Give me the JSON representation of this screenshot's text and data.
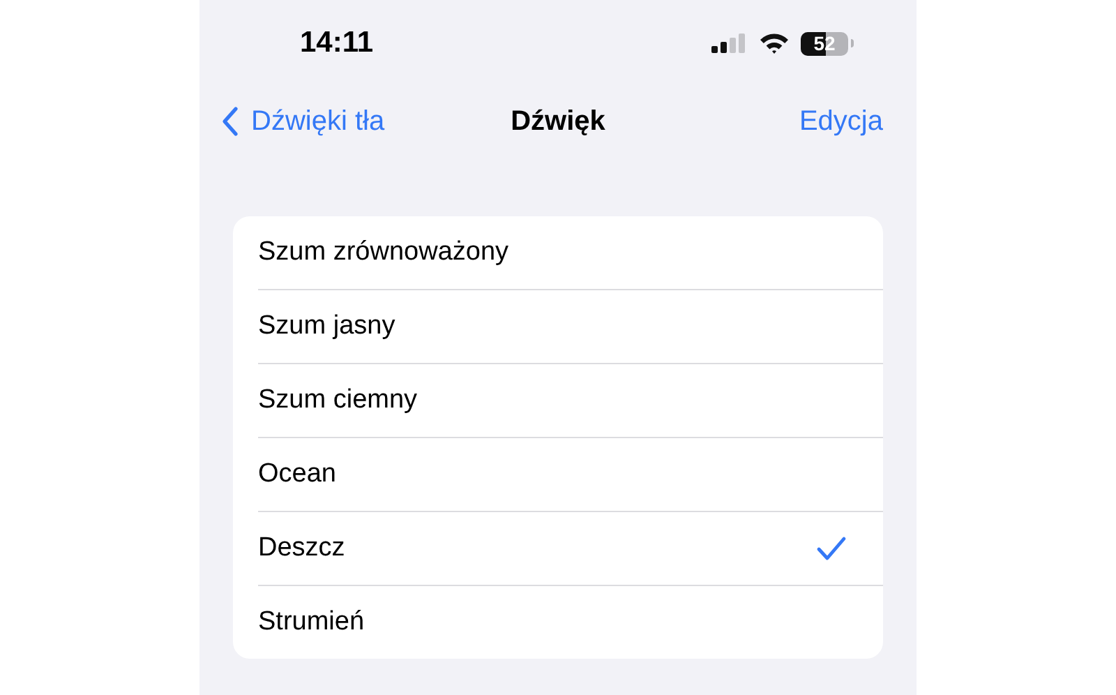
{
  "status_bar": {
    "time": "14:11",
    "battery": "52"
  },
  "nav": {
    "back": "Dźwięki tła",
    "title": "Dźwięk",
    "action": "Edycja"
  },
  "sounds": [
    {
      "label": "Szum zrównoważony",
      "selected": false
    },
    {
      "label": "Szum jasny",
      "selected": false
    },
    {
      "label": "Szum ciemny",
      "selected": false
    },
    {
      "label": "Ocean",
      "selected": false
    },
    {
      "label": "Deszcz",
      "selected": true
    },
    {
      "label": "Strumień",
      "selected": false
    }
  ]
}
